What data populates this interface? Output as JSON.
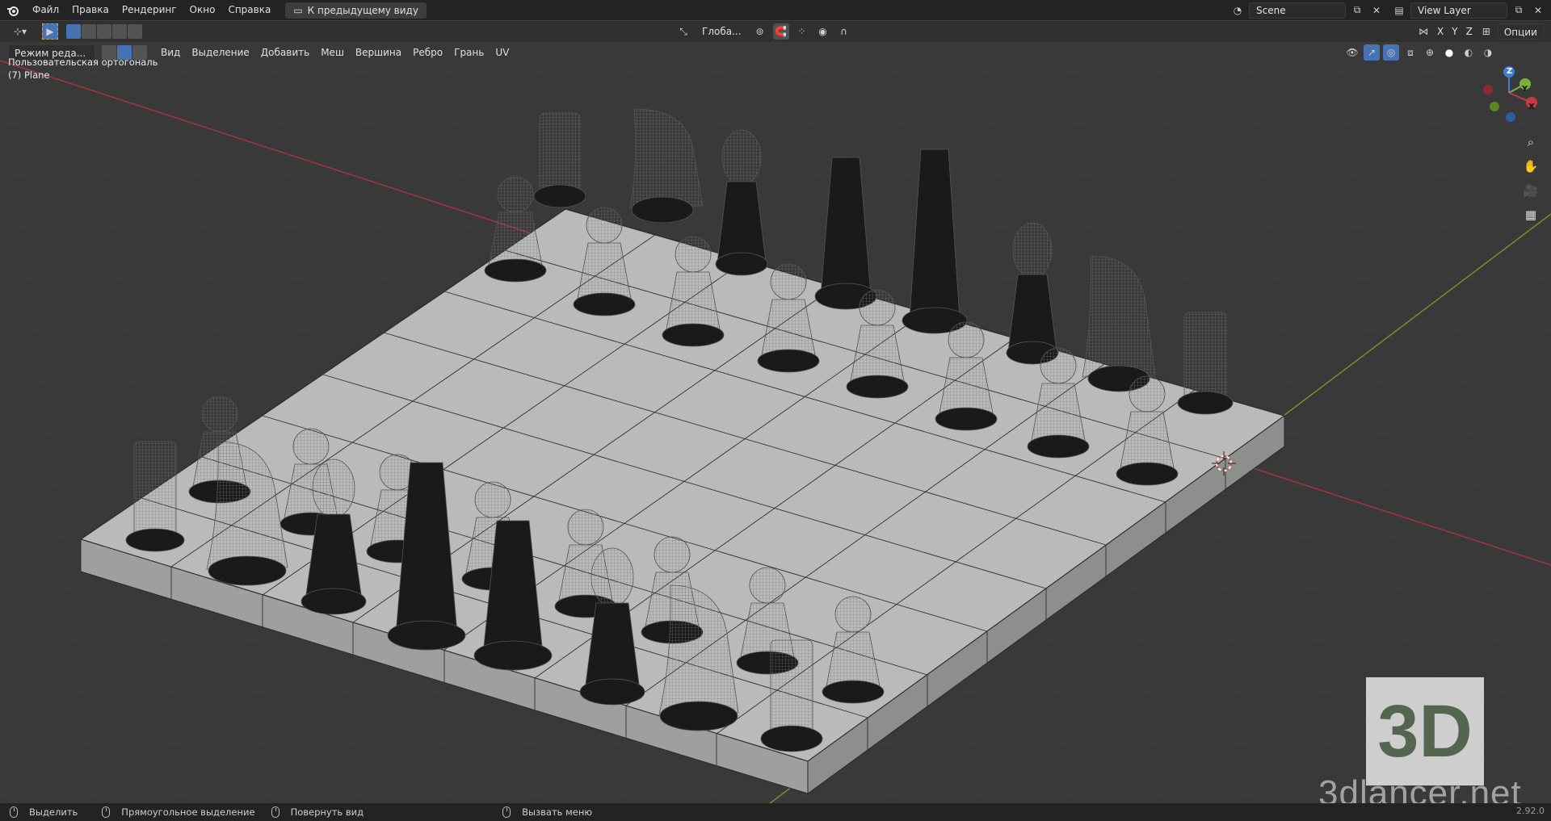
{
  "menu": {
    "items": [
      "Файл",
      "Правка",
      "Рендеринг",
      "Окно",
      "Справка"
    ],
    "back_button": "К предыдущему виду"
  },
  "scene": {
    "name": "Scene",
    "view_layer": "View Layer"
  },
  "header": {
    "mode": "Режим реда...",
    "view_menu": [
      "Вид",
      "Выделение",
      "Добавить",
      "Меш",
      "Вершина",
      "Ребро",
      "Грань",
      "UV"
    ],
    "transform_orientation": "Глоба...",
    "axes": [
      "X",
      "Y",
      "Z"
    ],
    "options": "Опции"
  },
  "viewport": {
    "view_name": "Пользовательская ортогональ",
    "object_name": "(7) Plane",
    "gizmo_labels": [
      "X",
      "Y",
      "Z"
    ]
  },
  "statusbar": {
    "select": "Выделить",
    "box_select": "Прямоугольное выделение",
    "rotate": "Повернуть вид",
    "call_menu": "Вызвать меню",
    "version": "2.92.0"
  },
  "watermark": {
    "logo_text": "3D",
    "site": "3dlancer.net"
  },
  "colors": {
    "accent": "#4772b3",
    "x_axis": "#c7383f",
    "y_axis": "#7fb03a",
    "z_axis": "#3a7fd8",
    "board": "#b9bbb8"
  }
}
